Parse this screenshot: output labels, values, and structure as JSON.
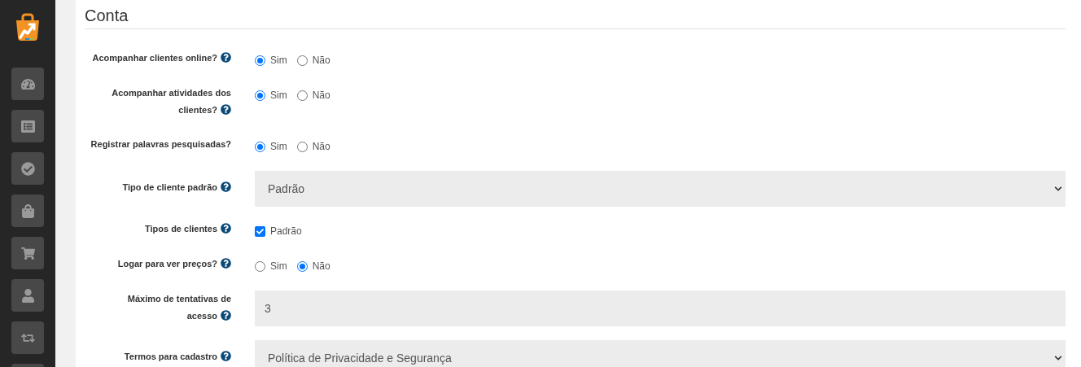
{
  "sidebar": {
    "items": [
      {
        "kind": "gauge"
      },
      {
        "kind": "list"
      },
      {
        "kind": "check"
      },
      {
        "kind": "bag"
      },
      {
        "kind": "cart"
      },
      {
        "kind": "user"
      },
      {
        "kind": "retweet"
      },
      {
        "kind": "blank"
      }
    ]
  },
  "section": {
    "title": "Conta"
  },
  "fields": [
    {
      "kind": "radio",
      "label": "Acompanhar clientes online?",
      "options": [
        {
          "label": "Sim",
          "selected": true
        },
        {
          "label": "Não",
          "selected": false
        }
      ]
    },
    {
      "kind": "radio",
      "label": "Acompanhar atividades dos clientes?",
      "options": [
        {
          "label": "Sim",
          "selected": true
        },
        {
          "label": "Não",
          "selected": false
        }
      ]
    },
    {
      "kind": "radio",
      "label": "Registrar palavras pesquisadas?",
      "help": false,
      "options": [
        {
          "label": "Sim",
          "selected": true
        },
        {
          "label": "Não",
          "selected": false
        }
      ]
    },
    {
      "kind": "select",
      "label": "Tipo de cliente padrão",
      "value": "Padrão"
    },
    {
      "kind": "checkbox",
      "label": "Tipos de clientes",
      "options": [
        {
          "label": "Padrão",
          "checked": true
        }
      ]
    },
    {
      "kind": "radio",
      "label": "Logar para ver preços?",
      "options": [
        {
          "label": "Sim",
          "selected": false
        },
        {
          "label": "Não",
          "selected": true
        }
      ]
    },
    {
      "kind": "input",
      "label": "Máximo de tentativas de acesso",
      "value": "3"
    },
    {
      "kind": "select",
      "label": "Termos para cadastro",
      "value": "Política de Privacidade e Segurança"
    }
  ]
}
